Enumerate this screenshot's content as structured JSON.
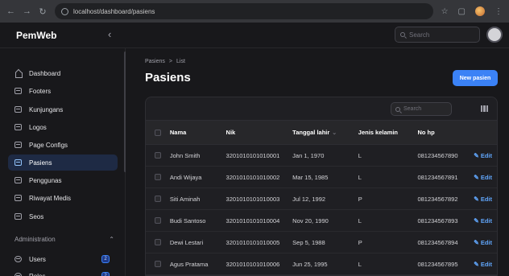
{
  "browser": {
    "url": "localhost/dashboard/pasiens"
  },
  "topbar": {
    "brand": "PemWeb",
    "search_placeholder": "Search"
  },
  "sidebar": {
    "items": [
      {
        "label": "Dashboard",
        "icon": "home-icon"
      },
      {
        "label": "Footers",
        "icon": "folder-icon"
      },
      {
        "label": "Kunjungans",
        "icon": "folder-icon"
      },
      {
        "label": "Logos",
        "icon": "folder-icon"
      },
      {
        "label": "Page Configs",
        "icon": "folder-icon"
      },
      {
        "label": "Pasiens",
        "icon": "folder-icon",
        "active": true
      },
      {
        "label": "Penggunas",
        "icon": "folder-icon"
      },
      {
        "label": "Riwayat Medis",
        "icon": "folder-icon"
      },
      {
        "label": "Seos",
        "icon": "folder-icon"
      }
    ],
    "group_label": "Administration",
    "admin_items": [
      {
        "label": "Users",
        "icon": "users-icon",
        "badge": "2"
      },
      {
        "label": "Roles",
        "icon": "shield-icon",
        "badge": "2"
      }
    ]
  },
  "main": {
    "breadcrumb": [
      "Pasiens",
      ">",
      "List"
    ],
    "title": "Pasiens",
    "new_button": "New pasien",
    "table_search_placeholder": "Search",
    "columns": [
      "Nama",
      "Nik",
      "Tanggal lahir",
      "Jenis kelamin",
      "No hp"
    ],
    "edit_label": "Edit",
    "rows": [
      {
        "nama": "John Smith",
        "nik": "3201010101010001",
        "tgl": "Jan 1, 1970",
        "jk": "L",
        "hp": "081234567890"
      },
      {
        "nama": "Andi Wijaya",
        "nik": "3201010101010002",
        "tgl": "Mar 15, 1985",
        "jk": "L",
        "hp": "081234567891"
      },
      {
        "nama": "Siti Aminah",
        "nik": "3201010101010003",
        "tgl": "Jul 12, 1992",
        "jk": "P",
        "hp": "081234567892"
      },
      {
        "nama": "Budi Santoso",
        "nik": "3201010101010004",
        "tgl": "Nov 20, 1990",
        "jk": "L",
        "hp": "081234567893"
      },
      {
        "nama": "Dewi Lestari",
        "nik": "3201010101010005",
        "tgl": "Sep 5, 1988",
        "jk": "P",
        "hp": "081234567894"
      },
      {
        "nama": "Agus Pratama",
        "nik": "3201010101010006",
        "tgl": "Jun 25, 1995",
        "jk": "L",
        "hp": "081234567895"
      }
    ]
  },
  "colors": {
    "accent": "#3b82f6",
    "background": "#18181b",
    "active_item": "#1e2a44"
  }
}
